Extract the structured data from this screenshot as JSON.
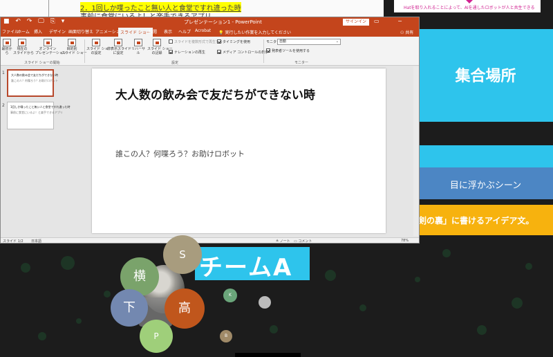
{
  "background_doc": {
    "line1": "2．1回しか喋ったこと無い人と食堂ですれ違った時",
    "line2": "事前に食堂にいるよ！と楽手できるアプリ"
  },
  "top_right_note": "Hatを取り入れることによって、AIを通したロボットが人と共生できる",
  "right_slides": {
    "meeting_place": "集合場所",
    "scene": "目に浮かぶシーン",
    "idea": "剣の裏」に書けるアイデア文。"
  },
  "ppt": {
    "window_title": "プレゼンテーション1 - PowerPoint",
    "signin": "サインイン",
    "quick_access": "■ ↶ ↷ 🖵 ⎘ ▾",
    "window_buttons": "▭ − ☐ ✕",
    "tabs": [
      "ファイル",
      "ホーム",
      "挿入",
      "デザイン",
      "画面切り替え",
      "アニメーション",
      "スライド ショー",
      "校閲",
      "表示",
      "ヘルプ",
      "Acrobat"
    ],
    "active_tab": "スライド ショー",
    "tell_me": "💡 実行したい作業を入力してください",
    "share": "⚇ 共有",
    "ribbon": {
      "btn_from_start": "最初から",
      "btn_from_current": "現在の\nスライドから",
      "btn_online": "オンライン\nプレゼンテーション",
      "btn_custom": "目的別\nスライド ショー",
      "group_start": "スライド ショーの開始",
      "btn_setup": "スライド ショー\nの設定",
      "btn_hide": "非表示スライド\nに設定",
      "btn_rehearse": "リハーサル",
      "btn_record": "スライド ショー\nの記録",
      "chk_mp": "スライドを複数形式で再生する",
      "chk_narration": "ナレーションの再生",
      "chk_timing": "タイミングを使用",
      "chk_media": "メディア コントロールの表示",
      "group_setup": "設定",
      "monitor_label": "モニター:",
      "monitor_value": "自動",
      "chk_presenter": "発表者ツールを使用する",
      "group_monitor": "モニター"
    },
    "thumbnails": [
      {
        "num": "1",
        "title": "大人数の飲み会で友だちができない時",
        "sub": "誰この人？何喋ろう？お助けロボット"
      },
      {
        "num": "2",
        "title": "1回しか喋ったこと無い人と食堂ですれ違った時",
        "sub": "事前に食堂にいるよ！と楽手できるアプリ"
      }
    ],
    "slide": {
      "title": "大人数の飲み会で友だちができない時",
      "body": "誰この人？何喋ろう？お助けロボット"
    },
    "status": {
      "slide_pos": "スライド 1/2",
      "lang": "日本語",
      "notes": "≜ ノート",
      "comments": "▭ コメント",
      "zoom": "78%"
    }
  },
  "team_banner": "チームA",
  "bubbles": [
    "S",
    "横",
    "下",
    "高",
    "P",
    "K",
    "B"
  ]
}
